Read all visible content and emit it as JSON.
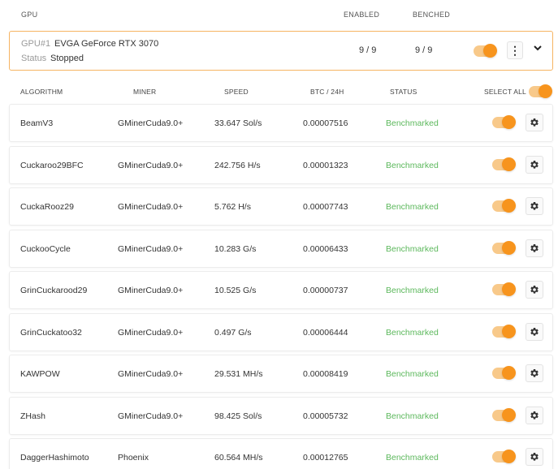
{
  "header": {
    "gpu": "GPU",
    "enabled": "ENABLED",
    "benched": "BENCHED"
  },
  "gpu_card": {
    "id_label": "GPU#1",
    "name": "EVGA GeForce RTX 3070",
    "status_label": "Status",
    "status_value": "Stopped",
    "enabled": "9 / 9",
    "benched": "9 / 9",
    "toggle_on": true
  },
  "columns": {
    "algorithm": "ALGORITHM",
    "miner": "MINER",
    "speed": "SPEED",
    "btc": "BTC / 24H",
    "status": "STATUS",
    "select_all": "SELECT ALL"
  },
  "rows": [
    {
      "algorithm": "BeamV3",
      "miner": "GMinerCuda9.0+",
      "speed": "33.647 Sol/s",
      "btc": "0.00007516",
      "status": "Benchmarked",
      "enabled": true
    },
    {
      "algorithm": "Cuckaroo29BFC",
      "miner": "GMinerCuda9.0+",
      "speed": "242.756 H/s",
      "btc": "0.00001323",
      "status": "Benchmarked",
      "enabled": true
    },
    {
      "algorithm": "CuckaRooz29",
      "miner": "GMinerCuda9.0+",
      "speed": "5.762 H/s",
      "btc": "0.00007743",
      "status": "Benchmarked",
      "enabled": true
    },
    {
      "algorithm": "CuckooCycle",
      "miner": "GMinerCuda9.0+",
      "speed": "10.283 G/s",
      "btc": "0.00006433",
      "status": "Benchmarked",
      "enabled": true
    },
    {
      "algorithm": "GrinCuckarood29",
      "miner": "GMinerCuda9.0+",
      "speed": "10.525 G/s",
      "btc": "0.00000737",
      "status": "Benchmarked",
      "enabled": true
    },
    {
      "algorithm": "GrinCuckatoo32",
      "miner": "GMinerCuda9.0+",
      "speed": "0.497 G/s",
      "btc": "0.00006444",
      "status": "Benchmarked",
      "enabled": true
    },
    {
      "algorithm": "KAWPOW",
      "miner": "GMinerCuda9.0+",
      "speed": "29.531 MH/s",
      "btc": "0.00008419",
      "status": "Benchmarked",
      "enabled": true
    },
    {
      "algorithm": "ZHash",
      "miner": "GMinerCuda9.0+",
      "speed": "98.425 Sol/s",
      "btc": "0.00005732",
      "status": "Benchmarked",
      "enabled": true
    },
    {
      "algorithm": "DaggerHashimoto",
      "miner": "Phoenix",
      "speed": "60.564 MH/s",
      "btc": "0.00012765",
      "status": "Benchmarked",
      "enabled": true
    }
  ],
  "colors": {
    "accent": "#f7941d",
    "status_ok": "#5cb85c",
    "card_border": "#f6b462"
  },
  "icons": {
    "settings": "gear-icon",
    "more": "kebab-icon",
    "expand": "chevron-down-icon"
  }
}
